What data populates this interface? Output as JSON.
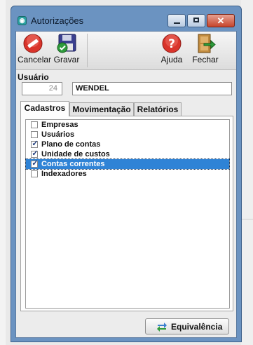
{
  "window": {
    "title": "Autorizações"
  },
  "toolbar": {
    "cancel_label": "Cancelar",
    "save_label": "Gravar",
    "help_label": "Ajuda",
    "close_label": "Fechar"
  },
  "user": {
    "label": "Usuário",
    "id": "24",
    "name": "WENDEL"
  },
  "tabs": [
    {
      "label": "Cadastros",
      "active": true
    },
    {
      "label": "Movimentação",
      "active": false
    },
    {
      "label": "Relatórios",
      "active": false
    }
  ],
  "permissions": [
    {
      "label": "Empresas",
      "checked": false,
      "selected": false
    },
    {
      "label": "Usuários",
      "checked": false,
      "selected": false
    },
    {
      "label": "Plano de contas",
      "checked": true,
      "selected": false
    },
    {
      "label": "Unidade de custos",
      "checked": true,
      "selected": false
    },
    {
      "label": "Contas correntes",
      "checked": true,
      "selected": true
    },
    {
      "label": "Indexadores",
      "checked": false,
      "selected": false
    }
  ],
  "equivalence_button": {
    "label": "Equivalência"
  },
  "colors": {
    "title_bar": "#6b93c1",
    "selection": "#2f83d6",
    "close_button": "#c6452c"
  }
}
